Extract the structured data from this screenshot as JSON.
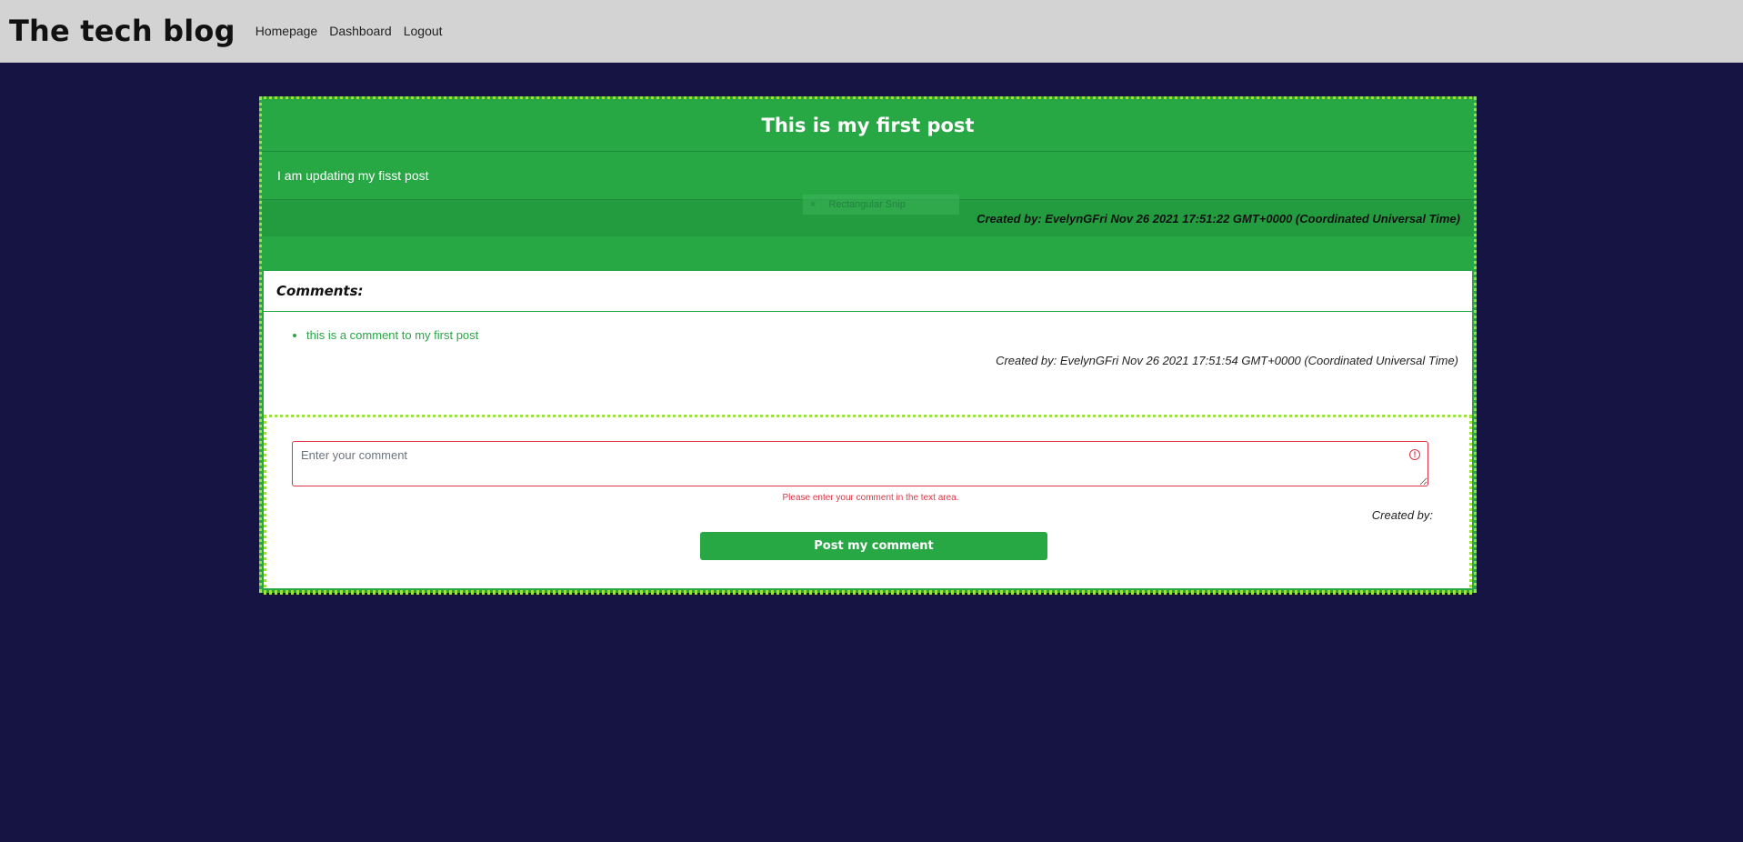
{
  "nav": {
    "brand": "The tech blog",
    "links": [
      "Homepage",
      "Dashboard",
      "Logout"
    ]
  },
  "post": {
    "title": "This is my first post",
    "body": "I am updating my fisst post",
    "created_by": "Created by: EvelynGFri Nov 26 2021 17:51:22 GMT+0000 (Coordinated Universal Time)"
  },
  "snip_overlay": {
    "close": "×",
    "label": "Rectangular Snip"
  },
  "comments": {
    "header": "Comments:",
    "items": [
      {
        "text": "this is a comment to my first post",
        "created_by": "Created by: EvelynGFri Nov 26 2021 17:51:54 GMT+0000 (Coordinated Universal Time)"
      }
    ]
  },
  "form": {
    "placeholder": "Enter your comment",
    "validation_message": "Please enter your comment in the text area.",
    "created_by_label": "Created by:",
    "submit_label": "Post my comment",
    "alert_icon": "!"
  },
  "colors": {
    "background": "#151442",
    "navbar": "#d3d3d3",
    "accent_green": "#28a745",
    "dotted_border": "#9be33b",
    "error_red": "#dc3545"
  }
}
